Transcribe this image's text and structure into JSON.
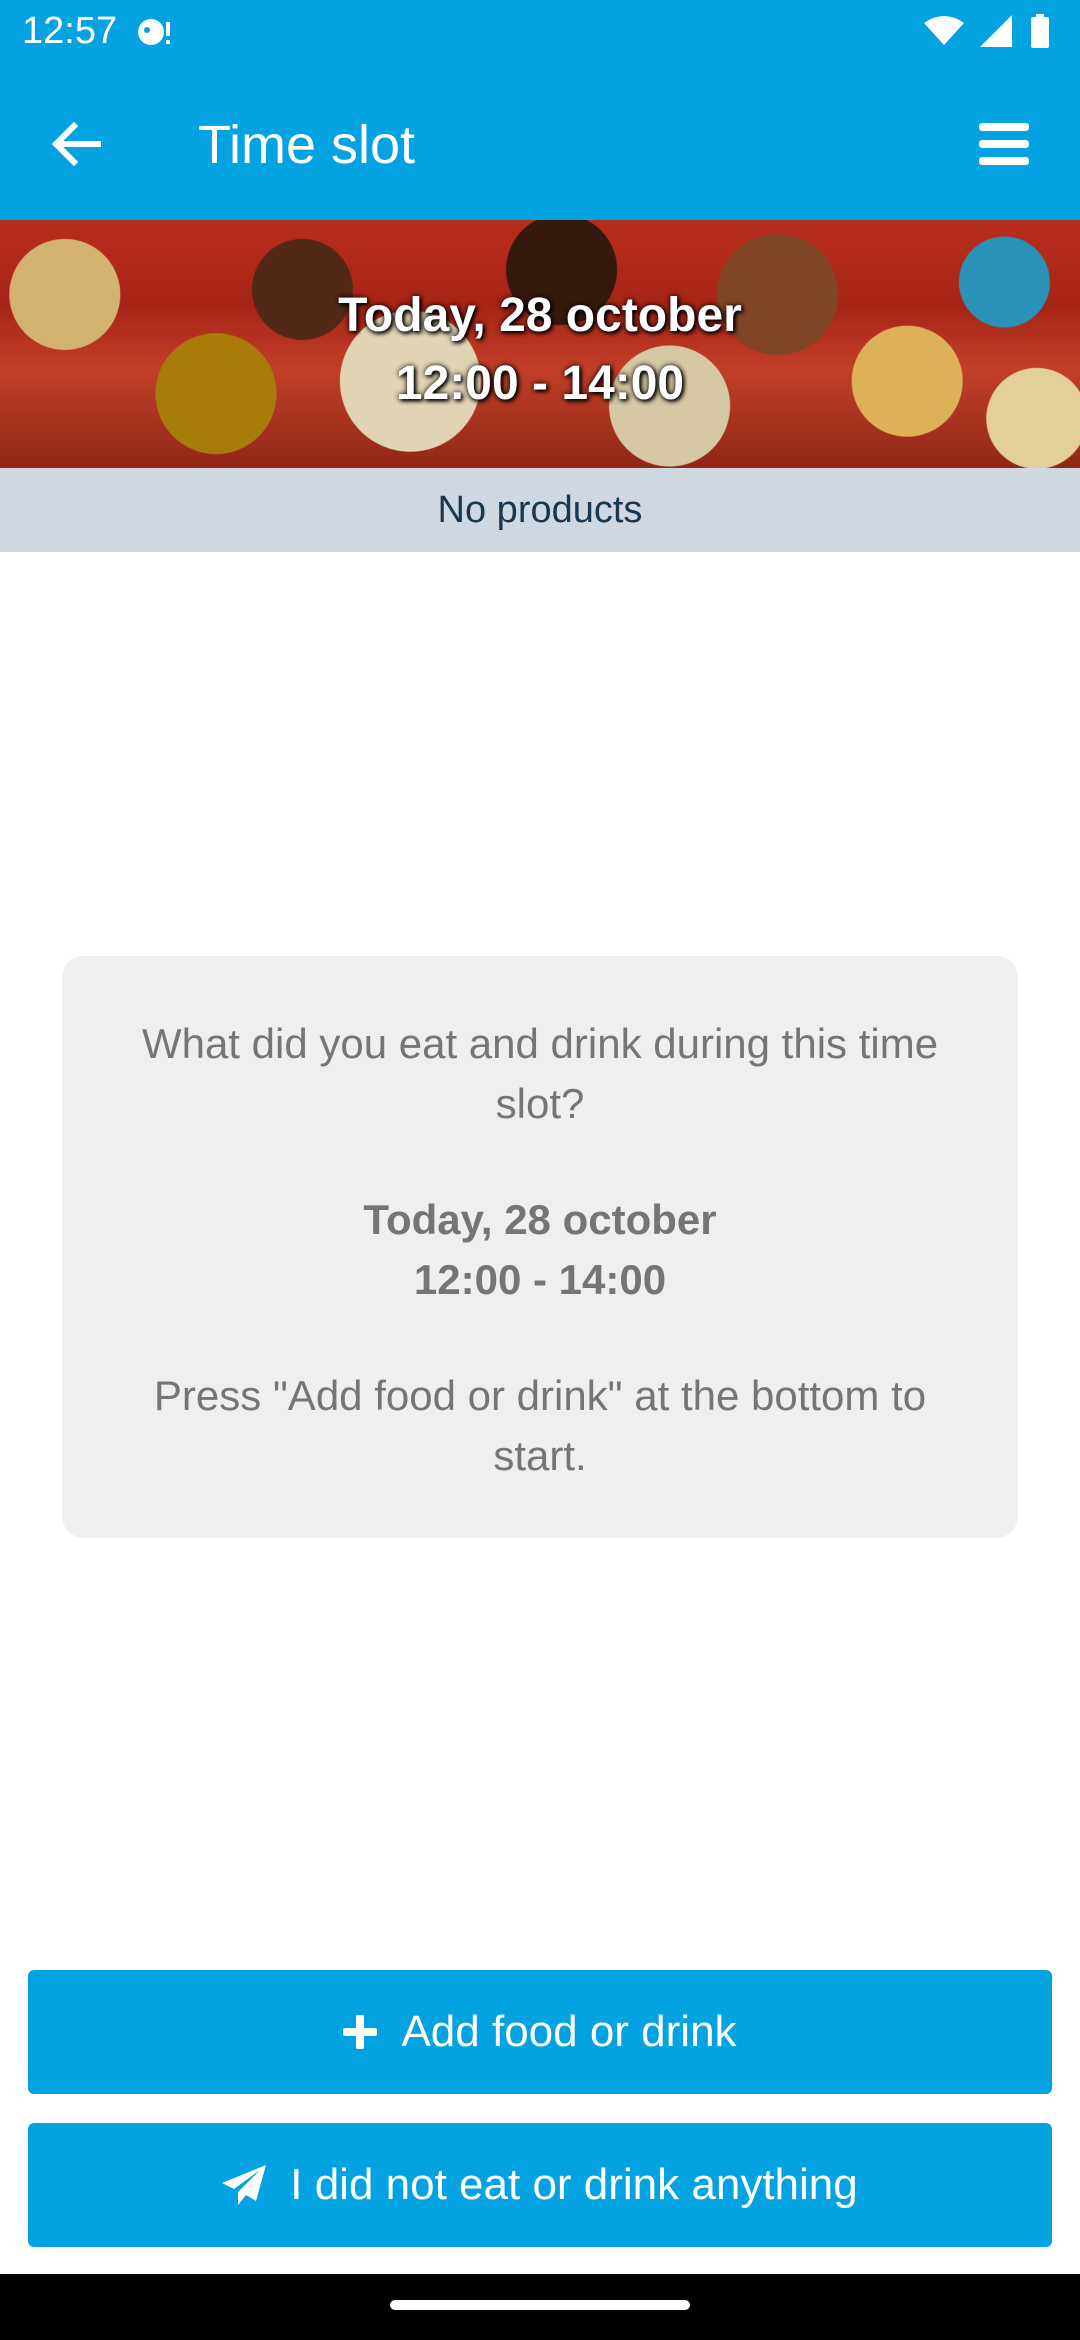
{
  "status_bar": {
    "time": "12:57",
    "icons": [
      "notification-icon",
      "wifi-icon",
      "signal-icon",
      "battery-icon"
    ]
  },
  "app_bar": {
    "title": "Time slot",
    "back_icon": "arrow-left-icon",
    "menu_icon": "hamburger-menu-icon"
  },
  "banner": {
    "date": "Today, 28 october",
    "time_range": "12:00 - 14:00"
  },
  "products": {
    "label": "No products"
  },
  "info_card": {
    "question": "What did you eat and drink during this time slot?",
    "date": "Today, 28 october",
    "time_range": "12:00 - 14:00",
    "hint": "Press \"Add food or drink\" at the bottom to start."
  },
  "actions": {
    "add_label": "Add food or drink",
    "add_icon": "plus-icon",
    "none_label": "I did not eat or drink anything",
    "none_icon": "paper-plane-icon"
  },
  "colors": {
    "primary": "#03a2e1",
    "products_bar": "#cfd8e0",
    "card_bg": "#efefef",
    "card_text": "#757575"
  }
}
